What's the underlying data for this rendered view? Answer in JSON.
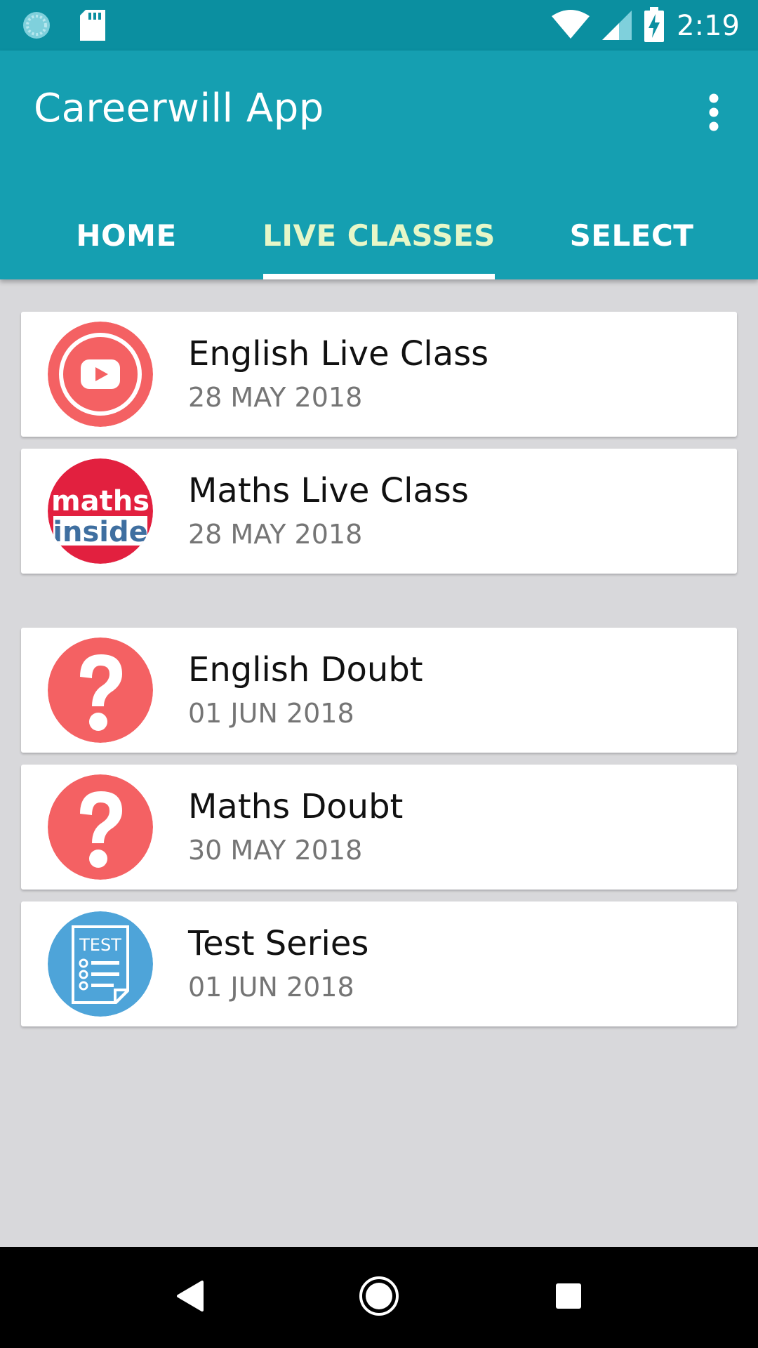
{
  "status_bar": {
    "time": "2:19",
    "icons": [
      "sync-icon",
      "sd-card-icon",
      "wifi-icon",
      "signal-icon",
      "battery-charging-icon"
    ]
  },
  "app_bar": {
    "title": "Careerwill App",
    "menu_icon": "overflow-menu-icon"
  },
  "tabs": [
    {
      "label": "HOME",
      "selected": false
    },
    {
      "label": "LIVE CLASSES",
      "selected": true
    },
    {
      "label": "SELECT",
      "selected": false
    }
  ],
  "items": [
    {
      "title": "English Live Class",
      "date": "28 MAY 2018",
      "icon": "youtube-play-icon"
    },
    {
      "title": "Maths Live Class",
      "date": "28 MAY 2018",
      "icon": "maths-inside-logo",
      "logo_text": [
        "maths",
        "inside"
      ]
    },
    {
      "title": "English Doubt",
      "date": "01 JUN 2018",
      "icon": "question-mark-icon"
    },
    {
      "title": "Maths Doubt",
      "date": "30 MAY 2018",
      "icon": "question-mark-icon"
    },
    {
      "title": "Test Series",
      "date": "01 JUN 2018",
      "icon": "test-document-icon",
      "logo_text": [
        "TEST"
      ]
    }
  ],
  "nav_bar": {
    "icons": [
      "back-icon",
      "home-icon",
      "recents-icon"
    ]
  },
  "colors": {
    "status_bar": "#0b8fa0",
    "app_bar": "#159fb1",
    "selected_tab_text": "#e6f7c8",
    "background": "#d8d8db",
    "coral": "#f46163",
    "maths_red": "#e2203f",
    "test_blue": "#4ea4d9"
  }
}
